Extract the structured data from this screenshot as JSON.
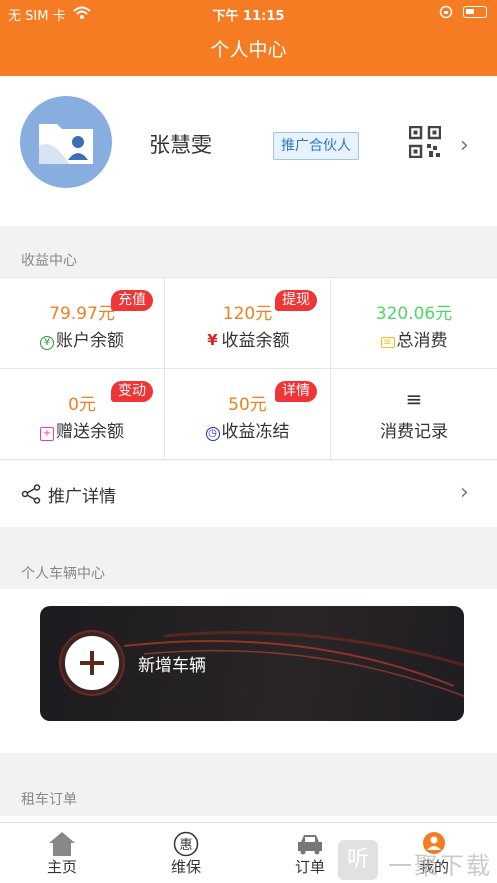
{
  "status_bar": {
    "carrier": "无 SIM 卡",
    "time": "下午 11:15"
  },
  "nav": {
    "title": "个人中心"
  },
  "profile": {
    "name": "张慧雯",
    "badge": "推广合伙人",
    "qr_icon": "qr-code-icon",
    "chevron_icon": "chevron-right-icon"
  },
  "earnings": {
    "section_title": "收益中心",
    "cells": [
      {
        "amount": "79.97元",
        "label": "账户余额",
        "badge": "充值",
        "icon": "yuan-coin-icon"
      },
      {
        "amount": "120元",
        "label": "收益余额",
        "badge": "提现",
        "icon": "yen-icon"
      },
      {
        "amount": "320.06元",
        "label": "总消费",
        "badge": "",
        "icon": "ticket-icon"
      },
      {
        "amount": "0元",
        "label": "赠送余额",
        "badge": "变动",
        "icon": "gift-icon"
      },
      {
        "amount": "50元",
        "label": "收益冻结",
        "badge": "详情",
        "icon": "clock-icon"
      },
      {
        "amount": "",
        "label": "消费记录",
        "badge": "",
        "icon": "list-icon"
      }
    ]
  },
  "promo": {
    "label": "推广详情",
    "icon": "share-icon"
  },
  "vehicle": {
    "section_title": "个人车辆中心",
    "add_label": "新增车辆"
  },
  "rental": {
    "section_title": "租车订单"
  },
  "tabs": [
    {
      "label": "主页",
      "icon": "home-icon"
    },
    {
      "label": "维保",
      "icon": "discount-icon"
    },
    {
      "label": "订单",
      "icon": "car-icon"
    },
    {
      "label": "我的",
      "icon": "user-icon"
    }
  ],
  "watermark": {
    "text": "一聚下载",
    "glyph": "听"
  },
  "colors": {
    "accent": "#f57c22",
    "badge": "#ef3535",
    "amount": "#f08020",
    "amount_green": "#4cd964"
  }
}
